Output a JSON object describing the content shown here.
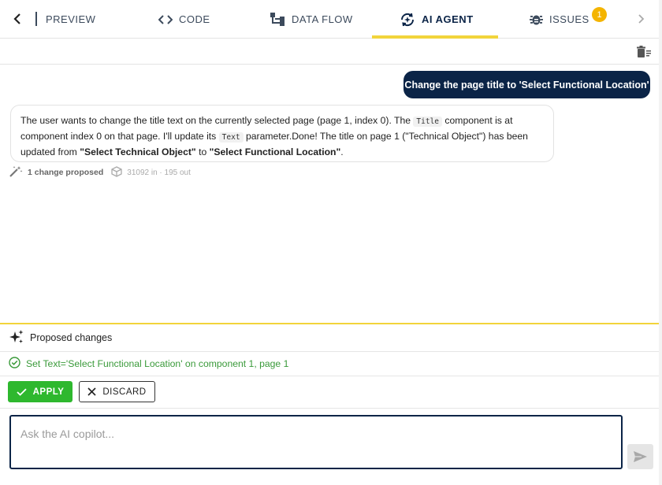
{
  "tabs": [
    {
      "label": "PREVIEW",
      "icon": "preview-icon"
    },
    {
      "label": "CODE",
      "icon": "code-icon"
    },
    {
      "label": "DATA FLOW",
      "icon": "data-flow-icon"
    },
    {
      "label": "AI AGENT",
      "icon": "ai-agent-icon",
      "active": true
    },
    {
      "label": "ISSUES",
      "icon": "bug-icon",
      "badge": "1"
    }
  ],
  "chat": {
    "user_message": "Change the page title to 'Select Functional Location'",
    "ai_message": {
      "part1": "The user wants to change the title text on the currently selected page (page 1, index 0). The ",
      "code1": "Title",
      "part2": " component is at component index 0 on that page. I'll update its ",
      "code2": "Text",
      "part3": " parameter.Done! The title on page 1 (\"Technical Object\") has been updated from ",
      "bold1": "\"Select Technical Object\"",
      "part4": " to ",
      "bold2": "\"Select Functional Location\"",
      "part5": "."
    },
    "meta": {
      "changes": "1 change proposed",
      "tokens": "31092 in · 195 out"
    }
  },
  "proposed": {
    "header": "Proposed changes",
    "items": [
      "Set Text='Select Functional Location' on component 1, page 1"
    ],
    "apply_label": "APPLY",
    "discard_label": "DISCARD"
  },
  "input": {
    "placeholder": "Ask the AI copilot..."
  },
  "colors": {
    "accent_navy": "#0b2447",
    "accent_yellow": "#f2d43b",
    "success_green": "#2eb82e",
    "badge_orange": "#f4b400"
  }
}
